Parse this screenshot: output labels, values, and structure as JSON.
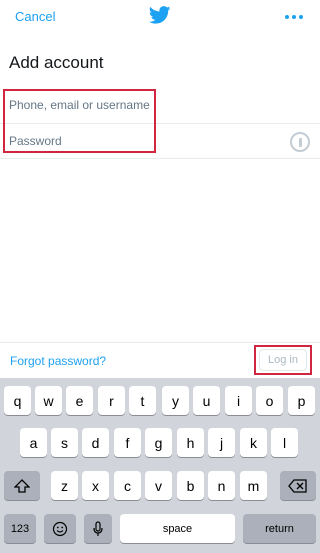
{
  "header": {
    "cancel_label": "Cancel",
    "logo_icon": "twitter-bird-icon",
    "more_icon": "more-dots-icon",
    "accent": "#1da1f2"
  },
  "title": "Add account",
  "form": {
    "username_placeholder": "Phone, email or username",
    "password_placeholder": "Password",
    "info_icon": "info-icon"
  },
  "footer": {
    "forgot_label": "Forgot password?",
    "login_label": "Log in"
  },
  "keyboard": {
    "row1": [
      "q",
      "w",
      "e",
      "r",
      "t",
      "y",
      "u",
      "i",
      "o",
      "p"
    ],
    "row2": [
      "a",
      "s",
      "d",
      "f",
      "g",
      "h",
      "j",
      "k",
      "l"
    ],
    "row3": [
      "z",
      "x",
      "c",
      "v",
      "b",
      "n",
      "m"
    ],
    "shift_icon": "shift-icon",
    "delete_icon": "backspace-icon",
    "numbers_label": "123",
    "emoji_icon": "emoji-icon",
    "mic_icon": "microphone-icon",
    "space_label": "space",
    "return_label": "return"
  },
  "highlight_color": "#d0263f"
}
